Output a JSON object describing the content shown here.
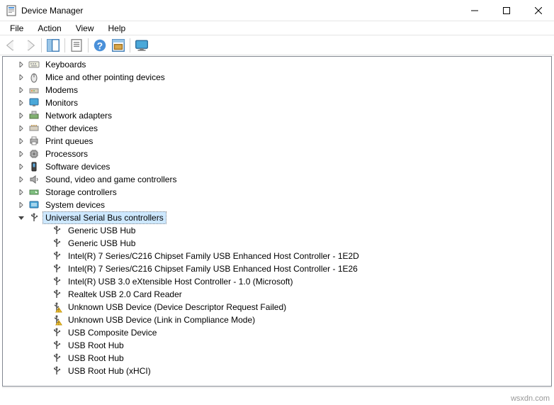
{
  "window": {
    "title": "Device Manager"
  },
  "menu": {
    "items": [
      "File",
      "Action",
      "View",
      "Help"
    ]
  },
  "categories": [
    {
      "label": "Keyboards",
      "icon": "keyboard"
    },
    {
      "label": "Mice and other pointing devices",
      "icon": "mouse"
    },
    {
      "label": "Modems",
      "icon": "modem"
    },
    {
      "label": "Monitors",
      "icon": "monitor"
    },
    {
      "label": "Network adapters",
      "icon": "network"
    },
    {
      "label": "Other devices",
      "icon": "other"
    },
    {
      "label": "Print queues",
      "icon": "printer"
    },
    {
      "label": "Processors",
      "icon": "cpu"
    },
    {
      "label": "Software devices",
      "icon": "software"
    },
    {
      "label": "Sound, video and game controllers",
      "icon": "sound"
    },
    {
      "label": "Storage controllers",
      "icon": "storage"
    },
    {
      "label": "System devices",
      "icon": "system"
    }
  ],
  "expanded": {
    "label": "Universal Serial Bus controllers",
    "icon": "usb",
    "children": [
      {
        "label": "Generic USB Hub",
        "icon": "usb"
      },
      {
        "label": "Generic USB Hub",
        "icon": "usb"
      },
      {
        "label": "Intel(R) 7 Series/C216 Chipset Family USB Enhanced Host Controller - 1E2D",
        "icon": "usb"
      },
      {
        "label": "Intel(R) 7 Series/C216 Chipset Family USB Enhanced Host Controller - 1E26",
        "icon": "usb"
      },
      {
        "label": "Intel(R) USB 3.0 eXtensible Host Controller - 1.0 (Microsoft)",
        "icon": "usb"
      },
      {
        "label": "Realtek USB 2.0 Card Reader",
        "icon": "usb"
      },
      {
        "label": "Unknown USB Device (Device Descriptor Request Failed)",
        "icon": "usb-warn"
      },
      {
        "label": "Unknown USB Device (Link in Compliance Mode)",
        "icon": "usb-warn"
      },
      {
        "label": "USB Composite Device",
        "icon": "usb"
      },
      {
        "label": "USB Root Hub",
        "icon": "usb"
      },
      {
        "label": "USB Root Hub",
        "icon": "usb"
      },
      {
        "label": "USB Root Hub (xHCI)",
        "icon": "usb"
      }
    ]
  },
  "watermark": "wsxdn.com"
}
